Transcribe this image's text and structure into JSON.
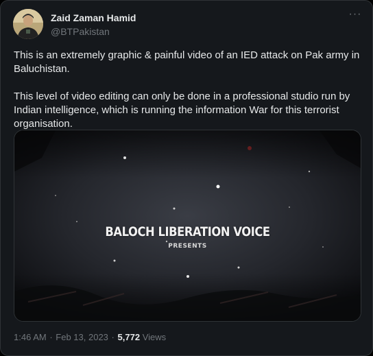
{
  "author": {
    "display_name": "Zaid Zaman Hamid",
    "handle": "@BTPakistan"
  },
  "menu": {
    "more_glyph": "···"
  },
  "tweet": {
    "paragraphs": [
      "This is an extremely graphic & painful video of an IED attack on Pak army in Baluchistan.",
      "This level of video editing can only be done in a professional studio run by Indian intelligence, which is running the information War for this terrorist organisation."
    ]
  },
  "media": {
    "title": "BALOCH LIBERATION VOICE",
    "subtitle": "PRESENTS"
  },
  "meta": {
    "time": "1:46 AM",
    "date": "Feb 13, 2023",
    "dot": "·",
    "views_count": "5,772",
    "views_label": "Views"
  },
  "colors": {
    "background": "#000000",
    "text": "#e7e9ea",
    "secondary_text": "#71767b",
    "border": "#2f3336"
  },
  "icons": [
    "more-icon",
    "avatar"
  ]
}
